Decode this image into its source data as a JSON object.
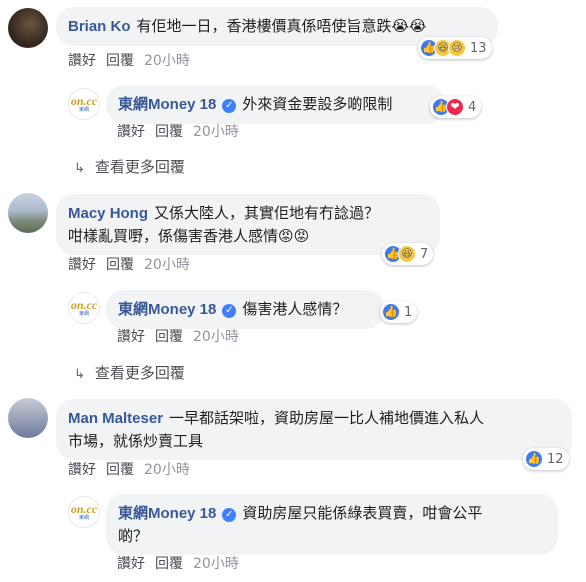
{
  "actions": {
    "like": "讚好",
    "reply": "回覆"
  },
  "more_replies": "查看更多回覆",
  "threads": [
    {
      "comment": {
        "author": "Brian Ko",
        "text": "有佢地一日，香港樓價真係唔使旨意跌😭😭",
        "time": "20小時",
        "reaction_count": "13"
      },
      "reply": {
        "author": "東網Money 18",
        "text": "外來資金要設多啲限制",
        "time": "20小時",
        "reaction_count": "4"
      }
    },
    {
      "comment": {
        "author": "Macy Hong",
        "text_line1": "又係大陸人，其實佢地有冇諗過？",
        "text_line2": "咁樣亂買嘢，係傷害香港人感情😡😡",
        "time": "20小時",
        "reaction_count": "7"
      },
      "reply": {
        "author": "東網Money 18",
        "text": "傷害港人感情？",
        "time": "20小時",
        "reaction_count": "1"
      }
    },
    {
      "comment": {
        "author": "Man Malteser",
        "text_line1": "一早都話架啦，資助房屋一比人補地價進入私人",
        "text_line2": "市場，就係炒賣工具",
        "time": "20小時",
        "reaction_count": "12"
      },
      "reply": {
        "author": "東網Money 18",
        "text_line1": "資助房屋只能係綠表買賣，咁會公平",
        "text_line2": "啲？",
        "time": "20小時"
      }
    }
  ],
  "logo": {
    "text": "on.cc",
    "sub": "東網"
  },
  "colors": {
    "name": "#385898",
    "bubble": "#f2f3f5",
    "like": "#3b7cf5"
  }
}
